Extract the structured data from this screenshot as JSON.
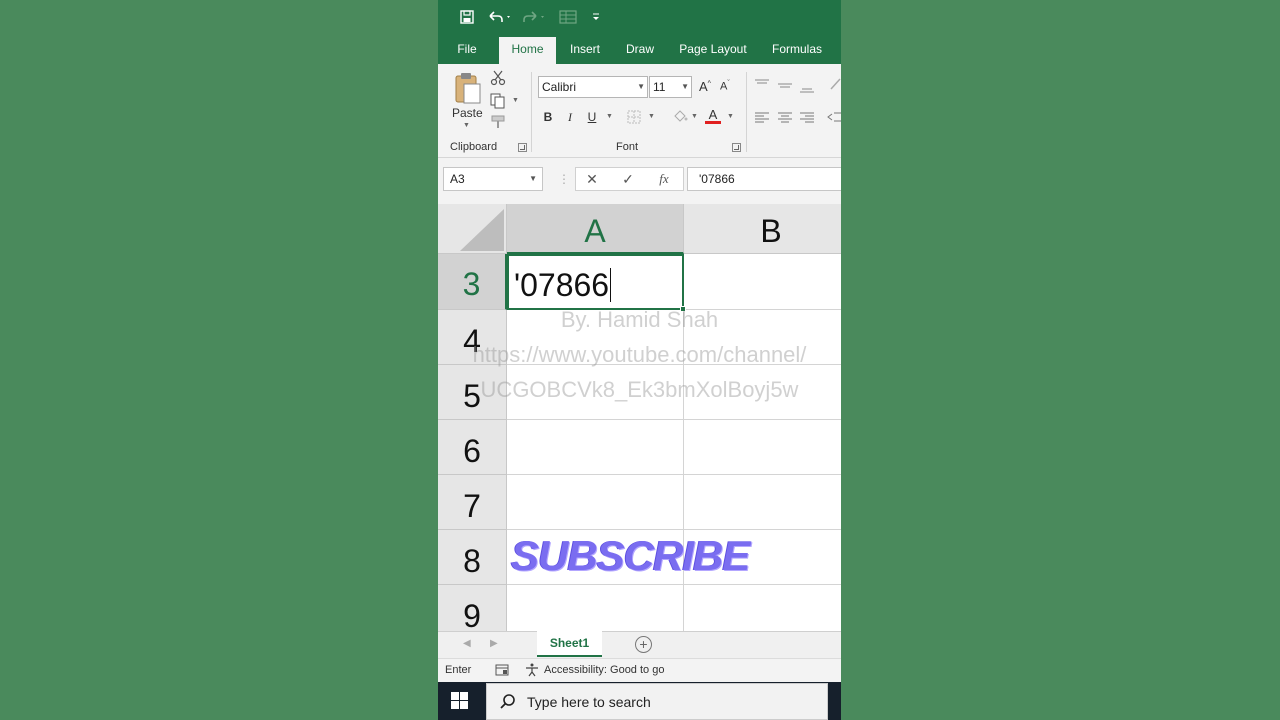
{
  "ribbon": {
    "tabs": [
      "File",
      "Home",
      "Insert",
      "Draw",
      "Page Layout",
      "Formulas"
    ],
    "active_tab": "Home",
    "clipboard": {
      "paste_label": "Paste",
      "group_label": "Clipboard"
    },
    "font": {
      "family": "Calibri",
      "size": "11",
      "bold": "B",
      "italic": "I",
      "underline": "U",
      "grow": "A",
      "shrink": "A",
      "font_color_letter": "A",
      "group_label": "Font"
    }
  },
  "formula_bar": {
    "name_box": "A3",
    "cancel": "✕",
    "enter": "✓",
    "fx": "fx",
    "content": "'07866"
  },
  "grid": {
    "columns": [
      "A",
      "B"
    ],
    "selected_column": "A",
    "rows": [
      "3",
      "4",
      "5",
      "6",
      "7",
      "8",
      "9"
    ],
    "selected_row": "3",
    "active_cell_value": "'07866"
  },
  "watermark": {
    "line1": "By. Hamid Shah",
    "line2": "https://www.youtube.com/channel/",
    "line3": "UCGOBCVk8_Ek3bmXolBoyj5w"
  },
  "overlay": {
    "subscribe": "SUBSCRIBE"
  },
  "sheets": {
    "tabs": [
      "Sheet1"
    ],
    "active": "Sheet1",
    "add": "+"
  },
  "status": {
    "mode": "Enter",
    "accessibility": "Accessibility: Good to go"
  },
  "taskbar": {
    "search_placeholder": "Type here to search"
  },
  "colors": {
    "excel_green": "#217346",
    "background": "#4a8a5c",
    "taskbar": "#16202c"
  }
}
